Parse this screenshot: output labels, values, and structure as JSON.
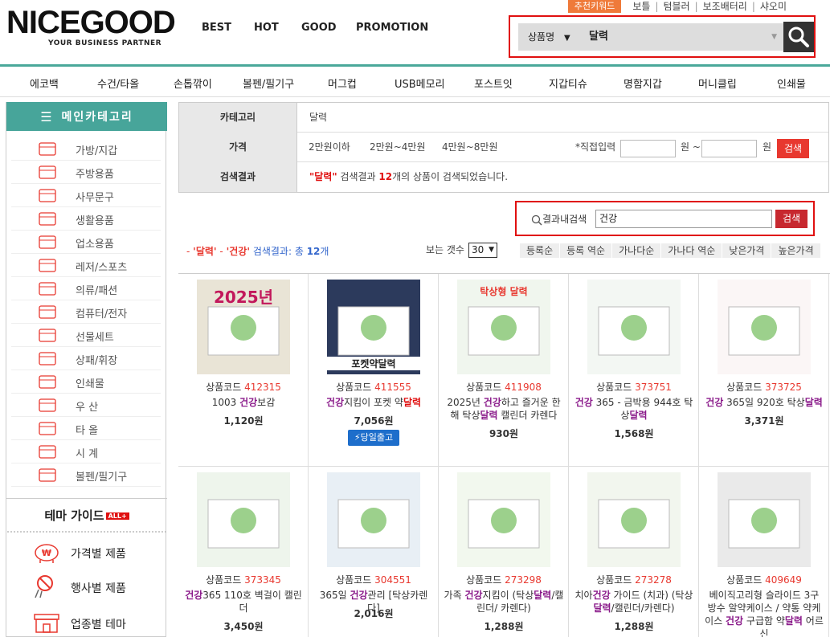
{
  "header": {
    "logo": "NICEGOOD",
    "tagline": "YOUR BUSINESS PARTNER",
    "nav": [
      "BEST",
      "HOT",
      "GOOD",
      "PROMOTION"
    ],
    "top_links": {
      "keyword": "추천키워드",
      "items": [
        "보틀",
        "텀블러",
        "보조배터리",
        "샤오미"
      ]
    },
    "search": {
      "select": "상품명",
      "value": "달력"
    }
  },
  "categories": [
    "에코백",
    "수건/타올",
    "손톱깎이",
    "볼펜/필기구",
    "머그컵",
    "USB메모리",
    "포스트잇",
    "지갑티슈",
    "명함지갑",
    "머니클립",
    "인쇄물"
  ],
  "sidebar": {
    "title": "메인카테고리",
    "items": [
      "가방/지갑",
      "주방용품",
      "사무문구",
      "생활용품",
      "업소용품",
      "레저/스포츠",
      "의류/패션",
      "컴퓨터/전자",
      "선물세트",
      "상패/휘장",
      "인쇄물",
      "우  산",
      "타  올",
      "시  계",
      "볼펜/필기구"
    ],
    "theme_title": "테마 가이드",
    "theme_badge": "ALL+",
    "theme_items": [
      "가격별 제품",
      "행사별 제품",
      "업종별 테마"
    ]
  },
  "filter": {
    "category_label": "카테고리",
    "category_value": "달력",
    "price_label": "가격",
    "prices": [
      "2만원이하",
      "2만원~4만원",
      "4만원~8만원"
    ],
    "direct": "*직접입력",
    "won1": "원 ~",
    "won2": "원",
    "search_btn": "검색",
    "result_label": "검색결과",
    "result_q": "\"달력\"",
    "result_mid": " 검색결과 ",
    "result_n": "12",
    "result_tail": "개의 상품이 검색되었습니다."
  },
  "within": {
    "label": "결과내검색",
    "value": "건강",
    "btn": "검색"
  },
  "result_line": {
    "t1": "- ",
    "k1": "'달력'",
    "t2": " - ",
    "k2": "'건강'",
    "t3": " 검색결과: 총 ",
    "n": "12",
    "t4": "개"
  },
  "per_page": {
    "label": "보는 갯수",
    "value": "30"
  },
  "sorts": [
    "등록순",
    "등록 역순",
    "가나다순",
    "가나다 역순",
    "낮은가격",
    "높은가격"
  ],
  "products": [
    {
      "code_label": "상품코드",
      "code": "412315",
      "name": [
        [
          "1003 ",
          ""
        ],
        [
          "건강",
          "p"
        ],
        [
          "보감",
          ""
        ]
      ],
      "price": "1,120원",
      "thumb_text": "2025년"
    },
    {
      "code_label": "상품코드",
      "code": "411555",
      "name": [
        [
          "건강",
          "p"
        ],
        "지킴이 포켓 약",
        [
          "달력",
          "r"
        ]
      ],
      "price": "7,056원",
      "badge": "당일출고",
      "thumb_text": "포켓약달력"
    },
    {
      "code_label": "상품코드",
      "code": "411908",
      "name": [
        "2025년 ",
        [
          "건강",
          "p"
        ],
        "하고 즐거운 한해 탁상",
        [
          "달력",
          "p"
        ],
        " 캘린더 카렌다"
      ],
      "price": "930원",
      "thumb_text": "탁상형 달력"
    },
    {
      "code_label": "상품코드",
      "code": "373751",
      "name": [
        [
          "건강",
          "p"
        ],
        " 365 - 금박용 944호 탁상",
        [
          "달력",
          "p"
        ]
      ],
      "price": "1,568원",
      "thumb_text": ""
    },
    {
      "code_label": "상품코드",
      "code": "373725",
      "name": [
        [
          "건강",
          "p"
        ],
        " 365일 920호 탁상",
        [
          "달력",
          "p"
        ]
      ],
      "price": "3,371원",
      "thumb_text": ""
    },
    {
      "code_label": "상품코드",
      "code": "373345",
      "name": [
        [
          "건강",
          "p"
        ],
        "365 110호 벽걸이 캘린더"
      ],
      "price": "3,450원",
      "thumb_text": ""
    },
    {
      "code_label": "상품코드",
      "code": "304551",
      "name": [
        "365일 ",
        [
          "건강",
          "p"
        ],
        "관리 [탁상카렌다]"
      ],
      "price": "2,016원",
      "thumb_text": ""
    },
    {
      "code_label": "상품코드",
      "code": "273298",
      "name": [
        "가족 ",
        [
          "건강",
          "p"
        ],
        "지킴이 (탁상",
        [
          "달력",
          "p"
        ],
        "/캘린더/ 카렌다)"
      ],
      "price": "1,288원",
      "thumb_text": ""
    },
    {
      "code_label": "상품코드",
      "code": "273278",
      "name": [
        "치아",
        [
          "건강",
          "p"
        ],
        " 가이드 (치과) (탁상",
        [
          "달력",
          "p"
        ],
        "/캘린더/카렌다)"
      ],
      "price": "1,288원",
      "thumb_text": ""
    },
    {
      "code_label": "상품코드",
      "code": "409649",
      "name": [
        "베이직고리형 슬라이드 3구 방수 알약케이스 / 약통 약케이스 ",
        [
          "건강",
          "p"
        ],
        " 구급함 약",
        [
          "달력",
          "p"
        ],
        " 어르신"
      ],
      "price": "",
      "thumb_text": ""
    }
  ],
  "colors": {
    "teal": "#47a59a",
    "red": "#e01010",
    "accent": "#e8382f",
    "purple": "#8a1a8a",
    "blue": "#3366cc"
  }
}
